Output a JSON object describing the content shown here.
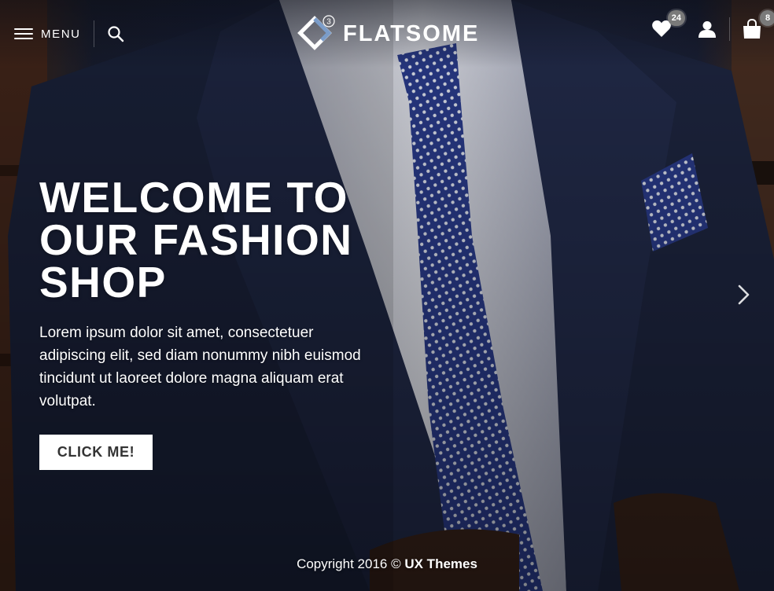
{
  "header": {
    "menu_label": "MENU",
    "logo_text": "FLATSOME",
    "logo_version": "3",
    "wishlist_count": "24",
    "cart_count": "8"
  },
  "icons": {
    "menu": "hamburger-icon",
    "search": "search-icon",
    "wishlist": "heart-icon",
    "account": "user-icon",
    "cart": "shopping-bag-icon",
    "next": "chevron-right-icon"
  },
  "hero": {
    "headline_lines": [
      "WELCOME TO",
      "OUR FASHION",
      "SHOP"
    ],
    "body": "Lorem ipsum dolor sit amet, consectetuer adipiscing elit, sed diam nonummy nibh euismod tincidunt ut laoreet dolore magna aliquam erat volutpat.",
    "button_label": "CLICK ME!"
  },
  "footer": {
    "copyright_prefix": "Copyright 2016 ©",
    "copyright_brand": "UX Themes"
  },
  "colors": {
    "suit": "#1f2742",
    "tie": "#2b3d8f",
    "shirt": "#dfe1ea",
    "badge": "#7a7a7a",
    "wood": "#4a2c1f"
  }
}
